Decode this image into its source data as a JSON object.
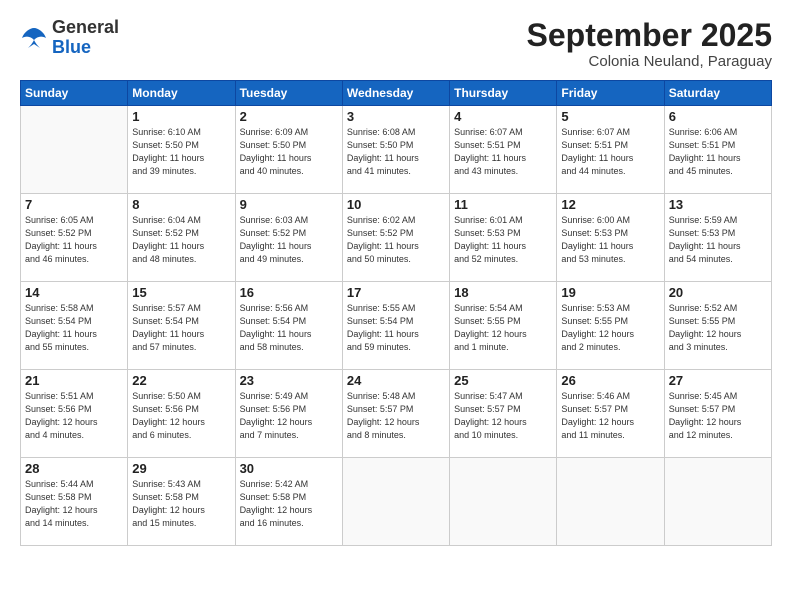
{
  "header": {
    "logo_general": "General",
    "logo_blue": "Blue",
    "month_title": "September 2025",
    "subtitle": "Colonia Neuland, Paraguay"
  },
  "days_of_week": [
    "Sunday",
    "Monday",
    "Tuesday",
    "Wednesday",
    "Thursday",
    "Friday",
    "Saturday"
  ],
  "weeks": [
    [
      {
        "day": "",
        "info": ""
      },
      {
        "day": "1",
        "info": "Sunrise: 6:10 AM\nSunset: 5:50 PM\nDaylight: 11 hours\nand 39 minutes."
      },
      {
        "day": "2",
        "info": "Sunrise: 6:09 AM\nSunset: 5:50 PM\nDaylight: 11 hours\nand 40 minutes."
      },
      {
        "day": "3",
        "info": "Sunrise: 6:08 AM\nSunset: 5:50 PM\nDaylight: 11 hours\nand 41 minutes."
      },
      {
        "day": "4",
        "info": "Sunrise: 6:07 AM\nSunset: 5:51 PM\nDaylight: 11 hours\nand 43 minutes."
      },
      {
        "day": "5",
        "info": "Sunrise: 6:07 AM\nSunset: 5:51 PM\nDaylight: 11 hours\nand 44 minutes."
      },
      {
        "day": "6",
        "info": "Sunrise: 6:06 AM\nSunset: 5:51 PM\nDaylight: 11 hours\nand 45 minutes."
      }
    ],
    [
      {
        "day": "7",
        "info": "Sunrise: 6:05 AM\nSunset: 5:52 PM\nDaylight: 11 hours\nand 46 minutes."
      },
      {
        "day": "8",
        "info": "Sunrise: 6:04 AM\nSunset: 5:52 PM\nDaylight: 11 hours\nand 48 minutes."
      },
      {
        "day": "9",
        "info": "Sunrise: 6:03 AM\nSunset: 5:52 PM\nDaylight: 11 hours\nand 49 minutes."
      },
      {
        "day": "10",
        "info": "Sunrise: 6:02 AM\nSunset: 5:52 PM\nDaylight: 11 hours\nand 50 minutes."
      },
      {
        "day": "11",
        "info": "Sunrise: 6:01 AM\nSunset: 5:53 PM\nDaylight: 11 hours\nand 52 minutes."
      },
      {
        "day": "12",
        "info": "Sunrise: 6:00 AM\nSunset: 5:53 PM\nDaylight: 11 hours\nand 53 minutes."
      },
      {
        "day": "13",
        "info": "Sunrise: 5:59 AM\nSunset: 5:53 PM\nDaylight: 11 hours\nand 54 minutes."
      }
    ],
    [
      {
        "day": "14",
        "info": "Sunrise: 5:58 AM\nSunset: 5:54 PM\nDaylight: 11 hours\nand 55 minutes."
      },
      {
        "day": "15",
        "info": "Sunrise: 5:57 AM\nSunset: 5:54 PM\nDaylight: 11 hours\nand 57 minutes."
      },
      {
        "day": "16",
        "info": "Sunrise: 5:56 AM\nSunset: 5:54 PM\nDaylight: 11 hours\nand 58 minutes."
      },
      {
        "day": "17",
        "info": "Sunrise: 5:55 AM\nSunset: 5:54 PM\nDaylight: 11 hours\nand 59 minutes."
      },
      {
        "day": "18",
        "info": "Sunrise: 5:54 AM\nSunset: 5:55 PM\nDaylight: 12 hours\nand 1 minute."
      },
      {
        "day": "19",
        "info": "Sunrise: 5:53 AM\nSunset: 5:55 PM\nDaylight: 12 hours\nand 2 minutes."
      },
      {
        "day": "20",
        "info": "Sunrise: 5:52 AM\nSunset: 5:55 PM\nDaylight: 12 hours\nand 3 minutes."
      }
    ],
    [
      {
        "day": "21",
        "info": "Sunrise: 5:51 AM\nSunset: 5:56 PM\nDaylight: 12 hours\nand 4 minutes."
      },
      {
        "day": "22",
        "info": "Sunrise: 5:50 AM\nSunset: 5:56 PM\nDaylight: 12 hours\nand 6 minutes."
      },
      {
        "day": "23",
        "info": "Sunrise: 5:49 AM\nSunset: 5:56 PM\nDaylight: 12 hours\nand 7 minutes."
      },
      {
        "day": "24",
        "info": "Sunrise: 5:48 AM\nSunset: 5:57 PM\nDaylight: 12 hours\nand 8 minutes."
      },
      {
        "day": "25",
        "info": "Sunrise: 5:47 AM\nSunset: 5:57 PM\nDaylight: 12 hours\nand 10 minutes."
      },
      {
        "day": "26",
        "info": "Sunrise: 5:46 AM\nSunset: 5:57 PM\nDaylight: 12 hours\nand 11 minutes."
      },
      {
        "day": "27",
        "info": "Sunrise: 5:45 AM\nSunset: 5:57 PM\nDaylight: 12 hours\nand 12 minutes."
      }
    ],
    [
      {
        "day": "28",
        "info": "Sunrise: 5:44 AM\nSunset: 5:58 PM\nDaylight: 12 hours\nand 14 minutes."
      },
      {
        "day": "29",
        "info": "Sunrise: 5:43 AM\nSunset: 5:58 PM\nDaylight: 12 hours\nand 15 minutes."
      },
      {
        "day": "30",
        "info": "Sunrise: 5:42 AM\nSunset: 5:58 PM\nDaylight: 12 hours\nand 16 minutes."
      },
      {
        "day": "",
        "info": ""
      },
      {
        "day": "",
        "info": ""
      },
      {
        "day": "",
        "info": ""
      },
      {
        "day": "",
        "info": ""
      }
    ]
  ]
}
